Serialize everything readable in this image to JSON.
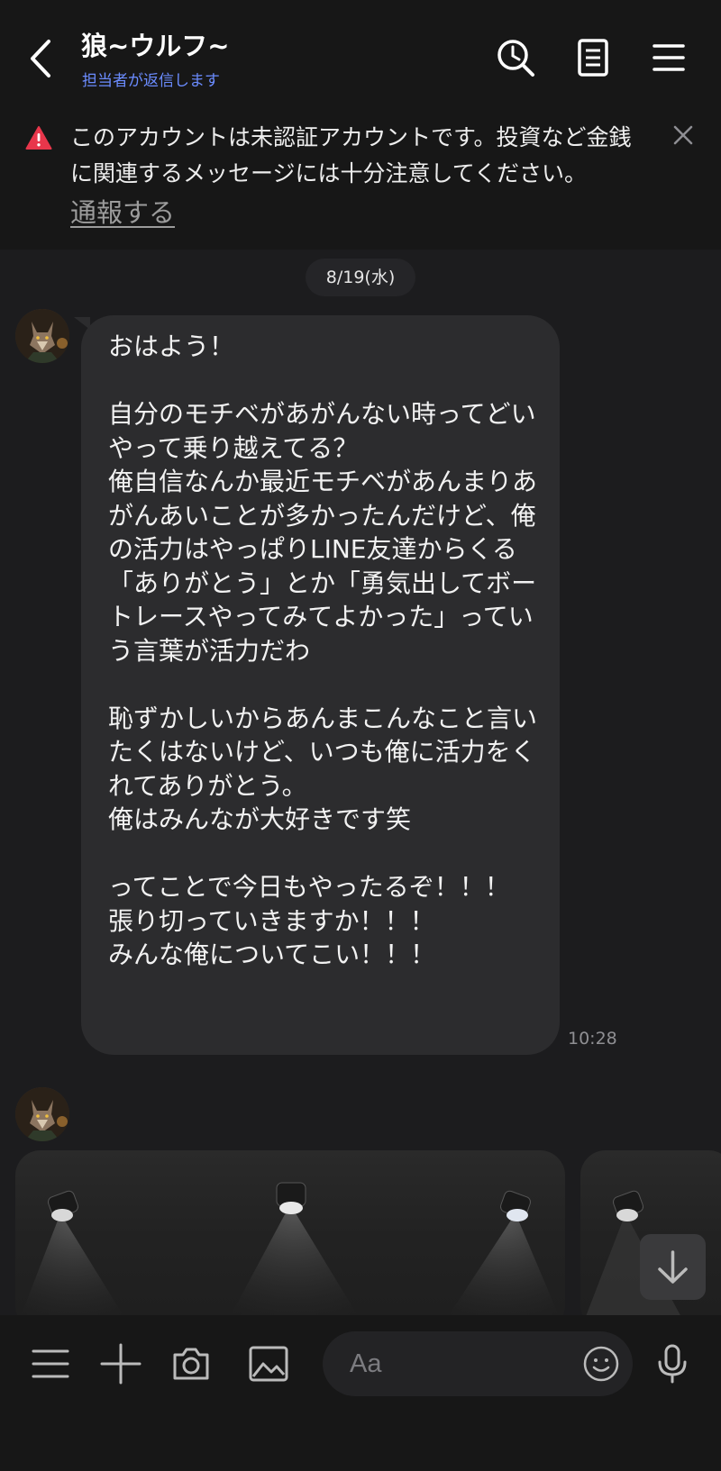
{
  "header": {
    "title": "狼~ウルフ~",
    "subtitle": "担当者が返信します",
    "icons": [
      "back-icon",
      "search-clock-icon",
      "notes-icon",
      "menu-icon"
    ]
  },
  "warning": {
    "text": "このアカウントは未認証アカウントです。投資など金銭に関連するメッセージには十分注意してください。",
    "link": "通報する"
  },
  "chat": {
    "date": "8/19(水)",
    "message": {
      "text": "おはよう！\n\n自分のモチベがあがんない時ってどいやって乗り越えてる？\n俺自信なんか最近モチベがあんまりあがんあいことが多かったんだけど、俺の活力はやっぱりLINE友達からくる「ありがとう」とか「勇気出してボートレースやってみてよかった」っていう言葉が活力だわ\n\n恥ずかしいからあんまこんなこと言いたくはないけど、いつも俺に活力をくれてありがとう。\n俺はみんなが大好きです笑\n\nってことで今日もやったるぞ！！！\n張り切っていきますか！！！\nみんな俺についてこい！！！",
      "time": "10:28"
    }
  },
  "composer": {
    "placeholder": "Aa"
  },
  "colors": {
    "background": "#1c1c1e",
    "bubble": "#2c2c2e",
    "subtitle": "#6b8cff",
    "warning_icon": "#e8364b"
  }
}
